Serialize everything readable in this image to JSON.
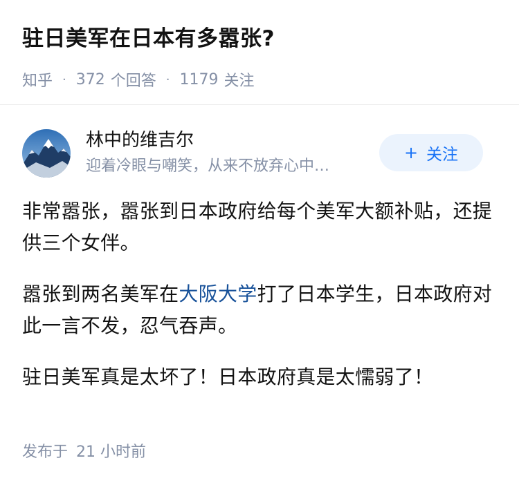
{
  "question": {
    "title": "驻日美军在日本有多嚣张?",
    "source": "知乎",
    "answers_count": "372",
    "answers_label": "个回答",
    "followers_count": "1179",
    "followers_label": "关注"
  },
  "author": {
    "name": "林中的维吉尔",
    "bio": "迎着冷眼与嘲笑，从来不放弃心中…",
    "follow_label": "关注",
    "follow_icon": "plus-icon"
  },
  "answer": {
    "p1": "非常嚣张，嚣张到日本政府给每个美军大额补贴，还提供三个女伴。",
    "p2_before": "嚣张到两名美军在",
    "p2_link": "大阪大学",
    "p2_after": "打了日本学生，日本政府对此一言不发，忍气吞声。",
    "p3": "驻日美军真是太坏了！日本政府真是太懦弱了！"
  },
  "published": {
    "label": "发布于",
    "time": "21 小时前"
  },
  "colors": {
    "link": "#175199",
    "accent": "#1772f6",
    "follow_bg": "#ebf3fd",
    "meta": "#8590a6"
  }
}
